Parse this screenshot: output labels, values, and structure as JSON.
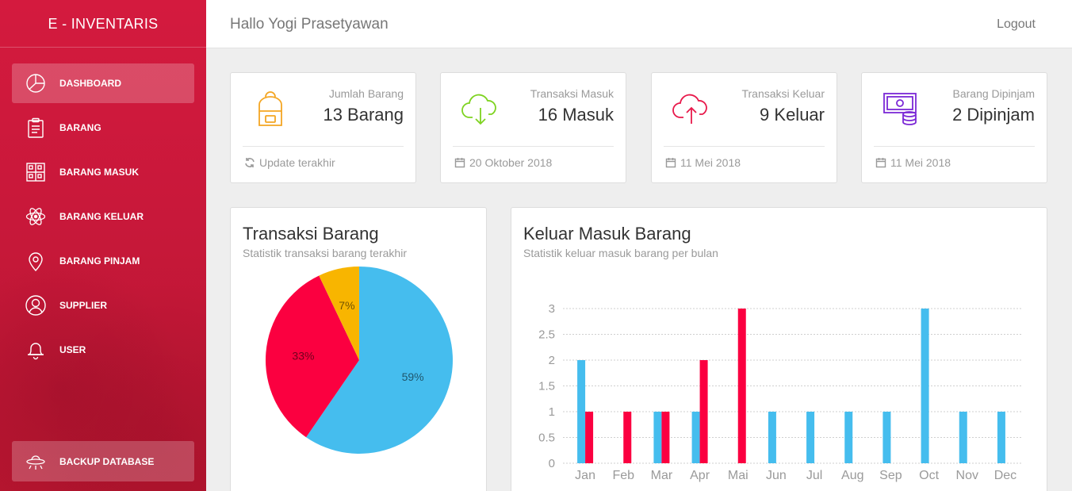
{
  "sidebar": {
    "brand": "E - INVENTARIS",
    "items": [
      {
        "label": "DASHBOARD",
        "icon": "pie-chart-icon",
        "active": true
      },
      {
        "label": "BARANG",
        "icon": "clipboard-icon",
        "active": false
      },
      {
        "label": "BARANG MASUK",
        "icon": "building-icon",
        "active": false
      },
      {
        "label": "BARANG KELUAR",
        "icon": "atom-icon",
        "active": false
      },
      {
        "label": "BARANG PINJAM",
        "icon": "map-pin-icon",
        "active": false
      },
      {
        "label": "SUPPLIER",
        "icon": "user-circle-icon",
        "active": false
      },
      {
        "label": "USER",
        "icon": "bell-icon",
        "active": false
      }
    ],
    "backup_label": "BACKUP DATABASE",
    "backup_icon": "ufo-icon"
  },
  "header": {
    "greeting": "Hallo Yogi Prasetyawan",
    "logout": "Logout"
  },
  "stats": [
    {
      "category": "Jumlah Barang",
      "value": "13 Barang",
      "footer": "Update terakhir",
      "icon": "backpack-icon",
      "footer_icon": "refresh-icon",
      "color": "#f4a623"
    },
    {
      "category": "Transaksi Masuk",
      "value": "16 Masuk",
      "footer": "20 Oktober 2018",
      "icon": "cloud-download-icon",
      "footer_icon": "calendar-icon",
      "color": "#7ed321"
    },
    {
      "category": "Transaksi Keluar",
      "value": "9 Keluar",
      "footer": "11 Mei 2018",
      "icon": "cloud-upload-icon",
      "footer_icon": "calendar-icon",
      "color": "#e8194b"
    },
    {
      "category": "Barang Dipinjam",
      "value": "2 Dipinjam",
      "footer": "11 Mei 2018",
      "icon": "money-coins-icon",
      "footer_icon": "calendar-icon",
      "color": "#7b28d6"
    }
  ],
  "pie_panel": {
    "title": "Transaksi Barang",
    "subtitle": "Statistik transaksi barang terakhir"
  },
  "bar_panel": {
    "title": "Keluar Masuk Barang",
    "subtitle": "Statistik keluar masuk barang per bulan"
  },
  "chart_data": [
    {
      "type": "pie",
      "slices": [
        {
          "label": "59%",
          "value": 59,
          "color": "#45bdee"
        },
        {
          "label": "33%",
          "value": 33,
          "color": "#fb0040"
        },
        {
          "label": "7%",
          "value": 7,
          "color": "#f8b500"
        }
      ]
    },
    {
      "type": "bar",
      "categories": [
        "Jan",
        "Feb",
        "Mar",
        "Apr",
        "Mai",
        "Jun",
        "Jul",
        "Aug",
        "Sep",
        "Oct",
        "Nov",
        "Dec"
      ],
      "series": [
        {
          "values": [
            2,
            0,
            1,
            1,
            0,
            1,
            1,
            1,
            1,
            3,
            1,
            1
          ],
          "color": "#45bdee"
        },
        {
          "values": [
            1,
            1,
            1,
            2,
            3,
            0,
            0,
            0,
            0,
            0,
            0,
            0
          ],
          "color": "#fb0040"
        }
      ],
      "yticks": [
        "0",
        "0.5",
        "1",
        "1.5",
        "2",
        "2.5",
        "3"
      ],
      "ylim": [
        0,
        3
      ],
      "grid": true
    }
  ]
}
